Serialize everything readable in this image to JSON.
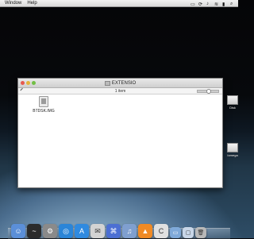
{
  "menubar": {
    "items": [
      "Window",
      "Help"
    ],
    "status_icons": [
      "display-icon",
      "sync-icon",
      "volume-icon",
      "wifi-icon",
      "battery-icon",
      "search-icon"
    ]
  },
  "window": {
    "title": "EXTENSIO",
    "status_text": "1 item",
    "file_name": "BTDSK.IMG"
  },
  "desktop_icons": [
    {
      "label": "Disk"
    },
    {
      "label": "Iomega"
    }
  ],
  "dock": {
    "items": [
      {
        "name": "finder-icon",
        "color": "#5b8fd8"
      },
      {
        "name": "activity-monitor-icon",
        "color": "#2b2b2b"
      },
      {
        "name": "system-preferences-icon",
        "color": "#8a8a8a"
      },
      {
        "name": "safari-icon",
        "color": "#2a85d8"
      },
      {
        "name": "app-store-icon",
        "color": "#2f8ae0"
      },
      {
        "name": "mail-icon",
        "color": "#d3d3d3"
      },
      {
        "name": "xcode-icon",
        "color": "#4c6fd3"
      },
      {
        "name": "itunes-icon",
        "color": "#7f9fcf"
      },
      {
        "name": "vlc-icon",
        "color": "#f08a24"
      },
      {
        "name": "calendar-icon",
        "color": "#e0e0e0"
      },
      {
        "name": "folder-icon",
        "color": "#7fa9d9"
      },
      {
        "name": "preview-icon",
        "color": "#c8d6e8"
      },
      {
        "name": "trash-icon",
        "color": "#b8b8b8"
      }
    ]
  }
}
